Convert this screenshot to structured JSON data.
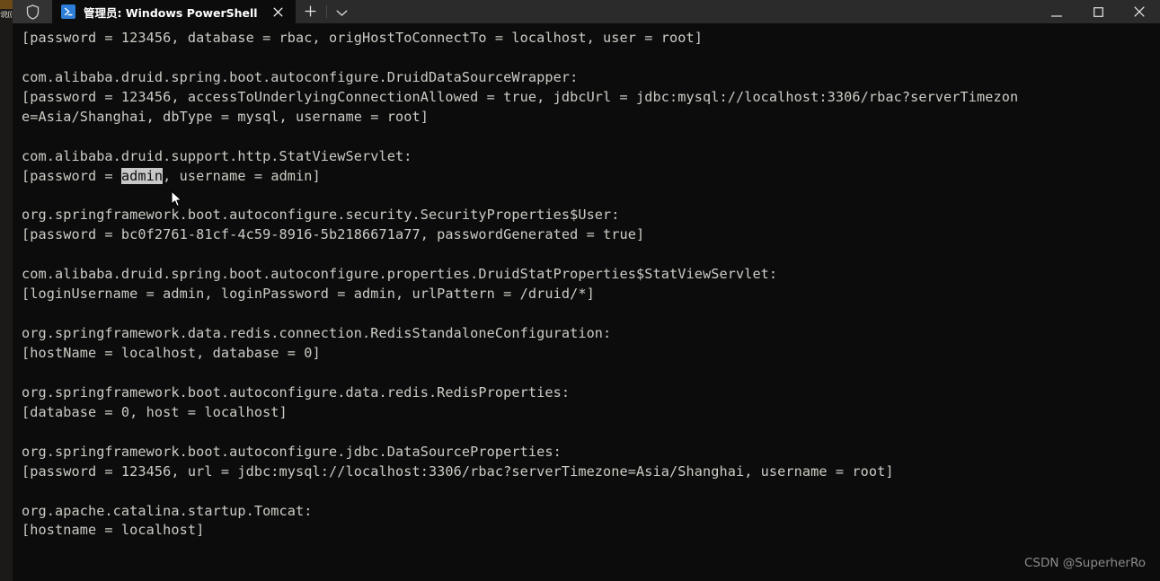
{
  "window": {
    "shield_icon": "shield-icon",
    "title": "管理员: Windows PowerShell",
    "tab_icon": "powershell-icon",
    "close_tab_label": "✕",
    "new_tab_label": "+",
    "dropdown_label": "⌄",
    "minimize_label": "—",
    "maximize_label": "▢",
    "close_label": "✕"
  },
  "background_window": {
    "sliver_text": "说((("
  },
  "terminal": {
    "selection": {
      "text": "admin",
      "background": "#c8c8c8",
      "foreground": "#0c0c0c"
    },
    "colors": {
      "background": "#0c0c0c",
      "foreground": "#ccccc6",
      "titlebar": "#2b2b2b",
      "accent": "#2d7ed8"
    },
    "lines": [
      "[password = 123456, database = rbac, origHostToConnectTo = localhost, user = root]",
      "",
      "com.alibaba.druid.spring.boot.autoconfigure.DruidDataSourceWrapper:",
      "[password = 123456, accessToUnderlyingConnectionAllowed = true, jdbcUrl = jdbc:mysql://localhost:3306/rbac?serverTimezon",
      "e=Asia/Shanghai, dbType = mysql, username = root]",
      "",
      "com.alibaba.druid.support.http.StatViewServlet:",
      "SELECTION_LINE",
      "",
      "org.springframework.boot.autoconfigure.security.SecurityProperties$User:",
      "[password = bc0f2761-81cf-4c59-8916-5b2186671a77, passwordGenerated = true]",
      "",
      "com.alibaba.druid.spring.boot.autoconfigure.properties.DruidStatProperties$StatViewServlet:",
      "[loginUsername = admin, loginPassword = admin, urlPattern = /druid/*]",
      "",
      "org.springframework.data.redis.connection.RedisStandaloneConfiguration:",
      "[hostName = localhost, database = 0]",
      "",
      "org.springframework.boot.autoconfigure.data.redis.RedisProperties:",
      "[database = 0, host = localhost]",
      "",
      "org.springframework.boot.autoconfigure.jdbc.DataSourceProperties:",
      "[password = 123456, url = jdbc:mysql://localhost:3306/rbac?serverTimezone=Asia/Shanghai, username = root]",
      "",
      "org.apache.catalina.startup.Tomcat:",
      "[hostname = localhost]"
    ],
    "selection_line": {
      "prefix": "[password = ",
      "selected": "admin",
      "suffix": ", username = admin]"
    }
  },
  "watermark": {
    "text": "CSDN @SuperherRo"
  }
}
